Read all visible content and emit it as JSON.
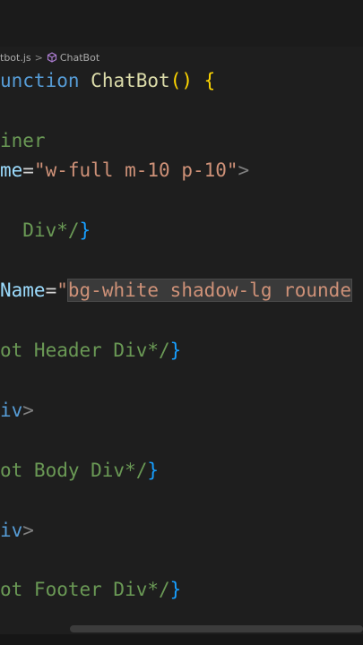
{
  "breadcrumb": {
    "file": "tbot.js",
    "symbol": "ChatBot",
    "separator": ">",
    "symbol_icon": "cube-icon"
  },
  "code": {
    "l1": {
      "a": "unction",
      "b": " ",
      "c": "ChatBot",
      "d": "()",
      "e": " {"
    },
    "l2": {
      "a": "iner"
    },
    "l3": {
      "a": "me",
      "b": "=",
      "c": "\"w-full m-10 p-10\"",
      "d": ">"
    },
    "l4": {
      "a": "Div*/",
      "b": "}"
    },
    "l5": {
      "a": "Name",
      "b": "=",
      "c": "\"",
      "d": "bg-white shadow-lg rounde"
    },
    "l6": {
      "a": "ot Header Div*/",
      "b": "}"
    },
    "l7": {
      "a": "iv",
      "b": ">"
    },
    "l8": {
      "a": "ot Body Div*/",
      "b": "}"
    },
    "l9": {
      "a": "iv",
      "b": ">"
    },
    "l10": {
      "a": "ot Footer Div*/",
      "b": "}"
    }
  },
  "colors": {
    "background": "#1e1e1e",
    "keyword": "#569cd6",
    "function": "#dcdcaa",
    "comment": "#6a9955",
    "attribute": "#9cdcfe",
    "string": "#ce9178",
    "bracket_gold": "#ffd700",
    "bracket_blue": "#179fff"
  }
}
